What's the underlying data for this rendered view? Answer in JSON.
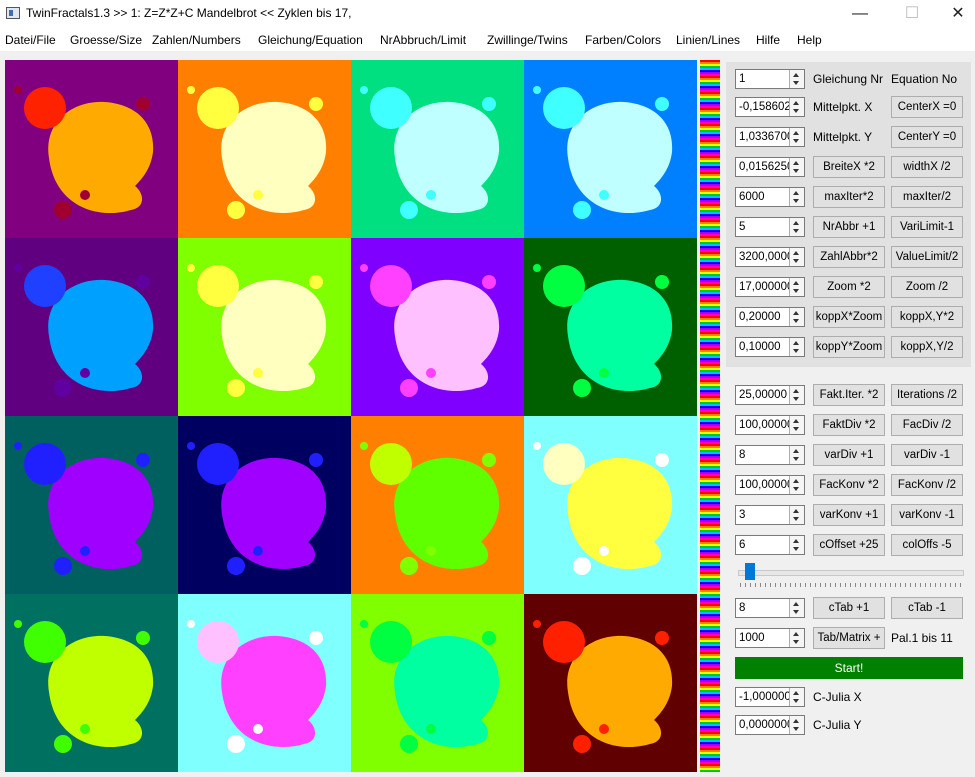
{
  "window": {
    "title": "TwinFractals1.3 >> 1: Z=Z*Z+C Mandelbrot << Zyklen bis 17,",
    "minimize_glyph": "—",
    "maximize_glyph": "☐",
    "close_glyph": "✕"
  },
  "menu": [
    "Datei/File",
    "Groesse/Size",
    "Zahlen/Numbers",
    "Gleichung/Equation",
    "NrAbbruch/Limit",
    "Zwillinge/Twins",
    "Farben/Colors",
    "Linien/Lines",
    "Hilfe",
    "Help"
  ],
  "tiles": [
    {
      "bg": "#800080",
      "main": "#ffaa00",
      "bulb": "#ff2200",
      "dots": "#a00030"
    },
    {
      "bg": "#ff8000",
      "main": "#ffffc0",
      "bulb": "#ffff40",
      "dots": "#ffff40"
    },
    {
      "bg": "#00e080",
      "main": "#c0ffff",
      "bulb": "#40ffff",
      "dots": "#40ffff"
    },
    {
      "bg": "#0080ff",
      "main": "#c0ffff",
      "bulb": "#40ffff",
      "dots": "#40ffff"
    },
    {
      "bg": "#600080",
      "main": "#00a0ff",
      "bulb": "#2040ff",
      "dots": "#6000a0"
    },
    {
      "bg": "#80ff00",
      "main": "#ffffc0",
      "bulb": "#ffff40",
      "dots": "#ffff40"
    },
    {
      "bg": "#8000ff",
      "main": "#ffc0ff",
      "bulb": "#ff40ff",
      "dots": "#ff40ff"
    },
    {
      "bg": "#006000",
      "main": "#00ffa0",
      "bulb": "#00ff40",
      "dots": "#00ff40"
    },
    {
      "bg": "#006060",
      "main": "#a000ff",
      "bulb": "#2020ff",
      "dots": "#2020ff"
    },
    {
      "bg": "#000060",
      "main": "#a000ff",
      "bulb": "#2020ff",
      "dots": "#2020ff"
    },
    {
      "bg": "#ff8000",
      "main": "#60ff00",
      "bulb": "#c0ff00",
      "dots": "#80ff00"
    },
    {
      "bg": "#80ffff",
      "main": "#ffff40",
      "bulb": "#ffffc0",
      "dots": "#ffffff"
    },
    {
      "bg": "#007060",
      "main": "#c0ff00",
      "bulb": "#40ff00",
      "dots": "#40ff00"
    },
    {
      "bg": "#80ffff",
      "main": "#ff40ff",
      "bulb": "#ffc0ff",
      "dots": "#ffffff"
    },
    {
      "bg": "#80ff00",
      "main": "#00ffa0",
      "bulb": "#00ff40",
      "dots": "#00ff40"
    },
    {
      "bg": "#600000",
      "main": "#ffaa00",
      "bulb": "#ff2000",
      "dots": "#ff2000"
    }
  ],
  "rows": [
    {
      "value": "1",
      "btn1": "",
      "label1": "Gleichung Nr",
      "btn2": "",
      "label2": "Equation No"
    },
    {
      "value": "-0,1586020",
      "btn1": "",
      "label1": "Mittelpkt. X",
      "btn2": "CenterX =0",
      "label2": ""
    },
    {
      "value": "1,0336700",
      "btn1": "",
      "label1": "Mittelpkt. Y",
      "btn2": "CenterY =0",
      "label2": ""
    },
    {
      "value": "0,0156250",
      "btn1": "BreiteX *2",
      "label1": "",
      "btn2": "widthX /2",
      "label2": ""
    },
    {
      "value": "6000",
      "btn1": "maxIter*2",
      "label1": "",
      "btn2": "maxIter/2",
      "label2": ""
    },
    {
      "value": "5",
      "btn1": "NrAbbr +1",
      "label1": "",
      "btn2": "VariLimit-1",
      "label2": ""
    },
    {
      "value": "3200,00000",
      "btn1": "ZahlAbbr*2",
      "label1": "",
      "btn2": "ValueLimit/2",
      "label2": ""
    },
    {
      "value": "17,000000",
      "btn1": "Zoom *2",
      "label1": "",
      "btn2": "Zoom /2",
      "label2": ""
    },
    {
      "value": "0,20000",
      "btn1": "koppX*Zoom",
      "label1": "",
      "btn2": "koppX,Y*2",
      "label2": ""
    },
    {
      "value": "0,10000",
      "btn1": "koppY*Zoom",
      "label1": "",
      "btn2": "koppX,Y/2",
      "label2": ""
    },
    {
      "value": "25,00000",
      "btn1": "Fakt.Iter. *2",
      "label1": "",
      "btn2": "Iterations /2",
      "label2": ""
    },
    {
      "value": "100,000000",
      "btn1": "FaktDiv *2",
      "label1": "",
      "btn2": "FacDiv /2",
      "label2": ""
    },
    {
      "value": "8",
      "btn1": "varDiv +1",
      "label1": "",
      "btn2": "varDiv -1",
      "label2": ""
    },
    {
      "value": "100,000000",
      "btn1": "FacKonv *2",
      "label1": "",
      "btn2": "FacKonv /2",
      "label2": ""
    },
    {
      "value": "3",
      "btn1": "varKonv +1",
      "label1": "",
      "btn2": "varKonv -1",
      "label2": ""
    },
    {
      "value": "6",
      "btn1": "cOffset +25",
      "label1": "",
      "btn2": "colOffs -5",
      "label2": ""
    },
    {
      "value": "8",
      "btn1": "cTab +1",
      "label1": "",
      "btn2": "cTab -1",
      "label2": ""
    },
    {
      "value": "1000",
      "btn1": "Tab/Matrix +",
      "label1": "",
      "btn2": "",
      "label2": "Pal.1 bis 11"
    },
    {
      "value": "-1,0000000",
      "btn1": "",
      "label1": "C-Julia X",
      "btn2": "",
      "label2": ""
    },
    {
      "value": "0,0000000",
      "btn1": "",
      "label1": "C-Julia Y",
      "btn2": "",
      "label2": ""
    }
  ],
  "start_label": "Start!",
  "slider_value": 0.03
}
